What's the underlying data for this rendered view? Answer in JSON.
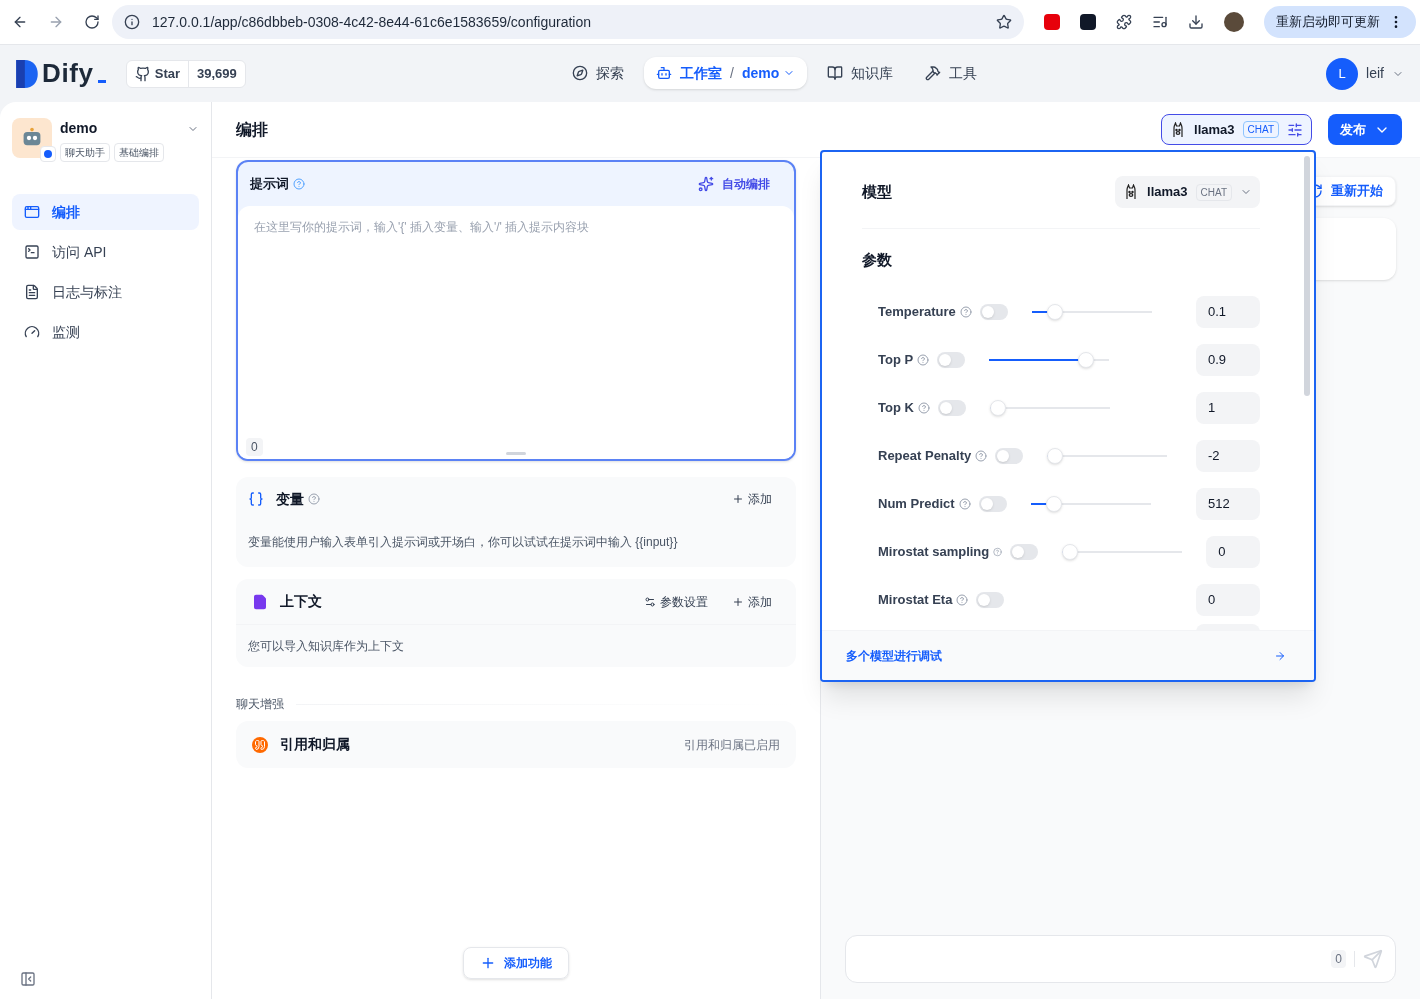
{
  "browser": {
    "url": "127.0.0.1/app/c86dbbeb-0308-4c42-8e44-61c6e1583659/configuration",
    "update_button": "重新启动即可更新"
  },
  "header": {
    "logo": "Dify",
    "star_label": "Star",
    "star_count": "39,699",
    "nav": [
      {
        "label": "探索",
        "selected": false,
        "kind": "explore"
      },
      {
        "label": "工作室",
        "separator": "/",
        "sub": "demo",
        "selected": true,
        "kind": "studio"
      },
      {
        "label": "知识库",
        "selected": false,
        "kind": "datasets"
      },
      {
        "label": "工具",
        "selected": false,
        "kind": "tools"
      }
    ],
    "user": {
      "initial": "L",
      "name": "leif"
    }
  },
  "sidebar": {
    "app": {
      "name": "demo",
      "tags": [
        "聊天助手",
        "基础编排"
      ]
    },
    "items": [
      {
        "label": "编排",
        "selected": true,
        "kind": "layout"
      },
      {
        "label": "访问 API",
        "selected": false,
        "kind": "terminal"
      },
      {
        "label": "日志与标注",
        "selected": false,
        "kind": "logs"
      },
      {
        "label": "监测",
        "selected": false,
        "kind": "gauge"
      }
    ]
  },
  "editor": {
    "title": "编排",
    "prompt": {
      "title": "提示词",
      "action": "自动编排",
      "placeholder": "在这里写你的提示词，输入'{' 插入变量、输入'/' 插入提示内容块",
      "count": "0"
    },
    "variables": {
      "title": "变量",
      "add": "添加",
      "description": "变量能使用户输入表单引入提示词或开场白，你可以试试在提示词中输入 {{input}}"
    },
    "context": {
      "title": "上下文",
      "settings": "参数设置",
      "add": "添加",
      "description": "您可以导入知识库作为上下文"
    },
    "section_label": "聊天增强",
    "citation": {
      "title": "引用和归属",
      "status": "引用和归属已启用"
    },
    "add_feature": "添加功能"
  },
  "toolbar": {
    "model": {
      "name": "llama3",
      "badge": "CHAT"
    },
    "publish": "发布"
  },
  "debug": {
    "restart": "重新开始",
    "input_count": "0"
  },
  "popover": {
    "model_label": "模型",
    "model": {
      "name": "llama3",
      "badge": "CHAT"
    },
    "params_label": "参数",
    "params": [
      {
        "name": "Temperature",
        "on": false,
        "kind": "slider",
        "level": 0.15,
        "value": "0.1"
      },
      {
        "name": "Top P",
        "on": false,
        "kind": "slider",
        "level": 0.85,
        "value": "0.9"
      },
      {
        "name": "Top K",
        "on": false,
        "kind": "slider",
        "level": 0,
        "value": "1"
      },
      {
        "name": "Repeat Penalty",
        "on": false,
        "kind": "slider",
        "level": 0,
        "value": "-2"
      },
      {
        "name": "Num Predict",
        "on": false,
        "kind": "slider",
        "level": 0.15,
        "value": "512"
      },
      {
        "name": "Mirostat sampling",
        "on": false,
        "kind": "slider",
        "level": 0,
        "value": "0"
      },
      {
        "name": "Mirostat Eta",
        "on": false,
        "kind": "plain",
        "value": "0"
      }
    ],
    "footer_link": "多个模型进行调试"
  }
}
